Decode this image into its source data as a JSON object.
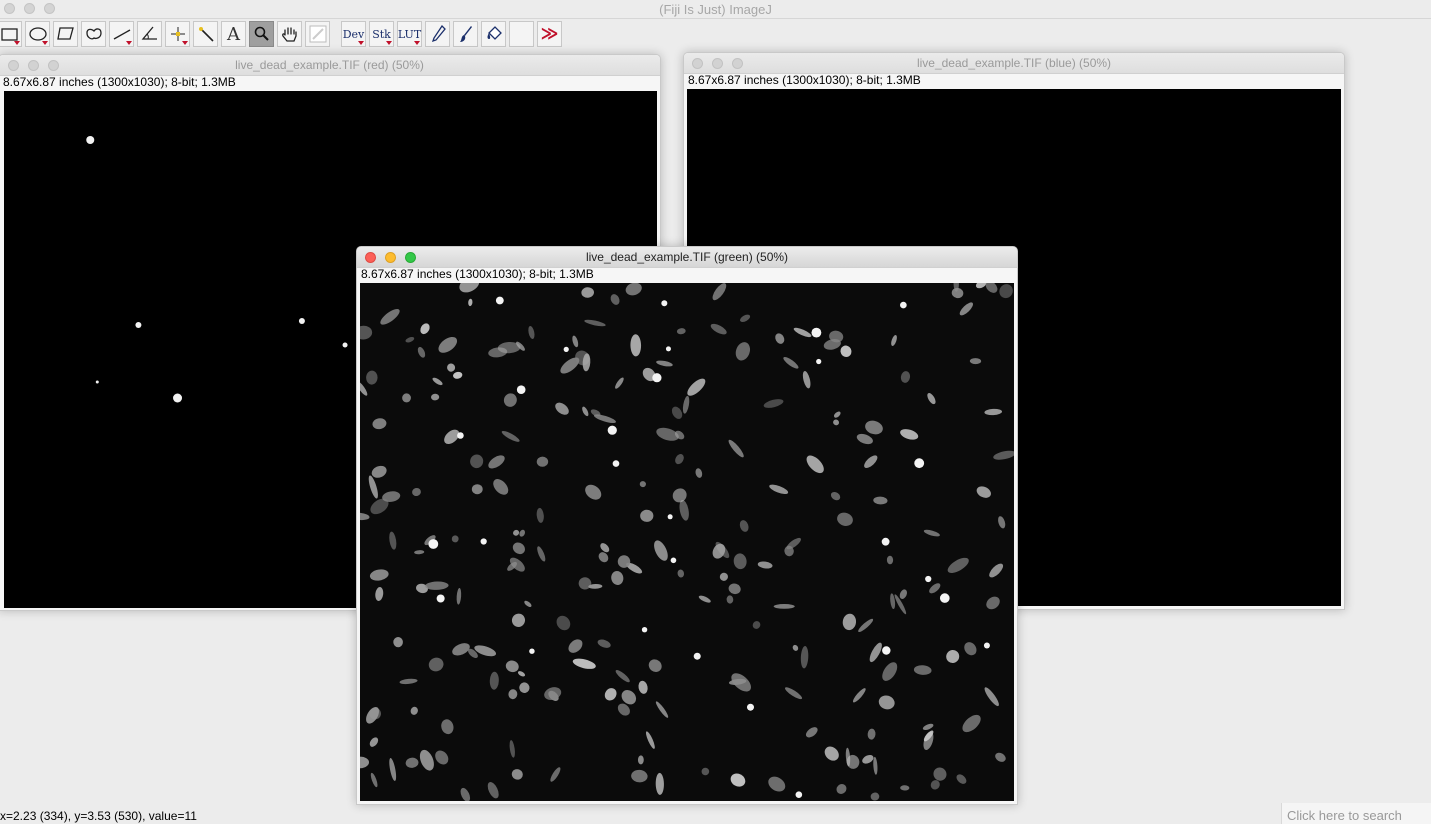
{
  "app": {
    "title": "(Fiji Is Just) ImageJ"
  },
  "toolbar": {
    "tools": [
      {
        "name": "rectangle-tool",
        "icon": "rectangle-icon",
        "has_menu": true
      },
      {
        "name": "oval-tool",
        "icon": "oval-icon",
        "has_menu": true
      },
      {
        "name": "polygon-tool",
        "icon": "polygon-icon",
        "has_menu": false
      },
      {
        "name": "freehand-tool",
        "icon": "freehand-icon",
        "has_menu": false
      },
      {
        "name": "line-tool",
        "icon": "line-icon",
        "has_menu": true
      },
      {
        "name": "angle-tool",
        "icon": "angle-icon",
        "has_menu": false
      },
      {
        "name": "point-tool",
        "icon": "point-icon",
        "has_menu": true
      },
      {
        "name": "wand-tool",
        "icon": "wand-icon",
        "has_menu": false
      },
      {
        "name": "text-tool",
        "icon": "text-icon",
        "label": "A",
        "has_menu": false
      },
      {
        "name": "magnifier-tool",
        "icon": "magnifier-icon",
        "selected": true
      },
      {
        "name": "hand-tool",
        "icon": "hand-icon"
      },
      {
        "name": "color-picker-tool",
        "icon": "color-picker-icon"
      },
      {
        "name": "dev-menu",
        "label": "Dev",
        "has_menu": true
      },
      {
        "name": "stk-menu",
        "label": "Stk",
        "has_menu": true
      },
      {
        "name": "lut-menu",
        "label": "LUT",
        "has_menu": true
      },
      {
        "name": "pencil-tool",
        "icon": "pencil-icon"
      },
      {
        "name": "brush-tool",
        "icon": "brush-icon"
      },
      {
        "name": "flood-fill-tool",
        "icon": "flood-fill-icon"
      },
      {
        "name": "empty-tool-slot",
        "icon": ""
      },
      {
        "name": "more-tools-button",
        "label": "≫"
      }
    ]
  },
  "windows": {
    "red": {
      "title": "live_dead_example.TIF (red) (50%)",
      "info": "8.67x6.87 inches (1300x1030); 8-bit; 1.3MB"
    },
    "blue": {
      "title": "live_dead_example.TIF (blue) (50%)",
      "info": "8.67x6.87 inches (1300x1030); 8-bit; 1.3MB"
    },
    "green": {
      "title": "live_dead_example.TIF (green) (50%)",
      "info": "8.67x6.87 inches (1300x1030); 8-bit; 1.3MB"
    }
  },
  "status": {
    "text": "x=2.23 (334), y=3.53 (530), value=11"
  },
  "search": {
    "placeholder": "Click here to search"
  },
  "colors": {
    "canvas_bg": "#000000",
    "window_bg": "#f6f6f6",
    "close_red": "#fc5f57",
    "minimize_yellow": "#fdbc2e",
    "zoom_green": "#33c748",
    "menu_arrow_red": "#c0102a"
  }
}
